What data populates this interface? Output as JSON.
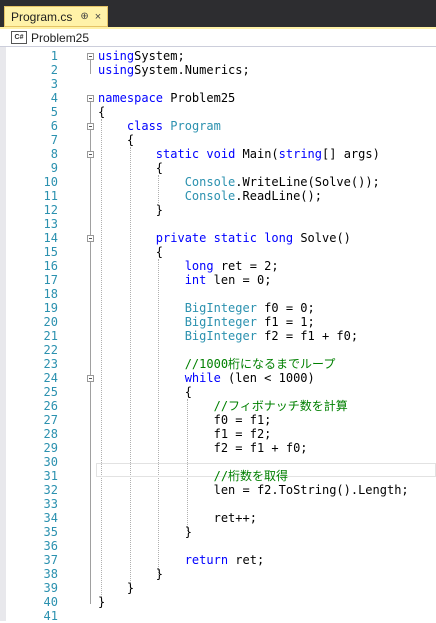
{
  "tab": {
    "title": "Program.cs",
    "pin": "⊕",
    "close": "×"
  },
  "navbar": {
    "icon": "C#",
    "label": "Problem25"
  },
  "lines": [
    [
      [
        "kw",
        "using"
      ],
      [
        "",
        "System;"
      ]
    ],
    [
      [
        "kw",
        "using"
      ],
      [
        "",
        "System.Numerics;"
      ]
    ],
    [],
    [
      [
        "kw",
        "namespace"
      ],
      [
        "",
        " Problem25"
      ]
    ],
    [
      [
        "",
        "{"
      ]
    ],
    [
      [
        "",
        "    "
      ],
      [
        "kw",
        "class"
      ],
      [
        "",
        " "
      ],
      [
        "ty",
        "Program"
      ]
    ],
    [
      [
        "",
        "    {"
      ]
    ],
    [
      [
        "",
        "        "
      ],
      [
        "kw",
        "static"
      ],
      [
        "",
        " "
      ],
      [
        "kw",
        "void"
      ],
      [
        "",
        " Main("
      ],
      [
        "kw",
        "string"
      ],
      [
        "",
        "[] args)"
      ]
    ],
    [
      [
        "",
        "        {"
      ]
    ],
    [
      [
        "",
        "            "
      ],
      [
        "ty",
        "Console"
      ],
      [
        "",
        ".WriteLine(Solve());"
      ]
    ],
    [
      [
        "",
        "            "
      ],
      [
        "ty",
        "Console"
      ],
      [
        "",
        ".ReadLine();"
      ]
    ],
    [
      [
        "",
        "        }"
      ]
    ],
    [],
    [
      [
        "",
        "        "
      ],
      [
        "kw",
        "private"
      ],
      [
        "",
        " "
      ],
      [
        "kw",
        "static"
      ],
      [
        "",
        " "
      ],
      [
        "kw",
        "long"
      ],
      [
        "",
        " Solve()"
      ]
    ],
    [
      [
        "",
        "        {"
      ]
    ],
    [
      [
        "",
        "            "
      ],
      [
        "kw",
        "long"
      ],
      [
        "",
        " ret = 2;"
      ]
    ],
    [
      [
        "",
        "            "
      ],
      [
        "kw",
        "int"
      ],
      [
        "",
        " len = 0;"
      ]
    ],
    [],
    [
      [
        "",
        "            "
      ],
      [
        "ty",
        "BigInteger"
      ],
      [
        "",
        " f0 = 0;"
      ]
    ],
    [
      [
        "",
        "            "
      ],
      [
        "ty",
        "BigInteger"
      ],
      [
        "",
        " f1 = 1;"
      ]
    ],
    [
      [
        "",
        "            "
      ],
      [
        "ty",
        "BigInteger"
      ],
      [
        "",
        " f2 = f1 + f0;"
      ]
    ],
    [],
    [
      [
        "",
        "            "
      ],
      [
        "cm",
        "//1000桁になるまでループ"
      ]
    ],
    [
      [
        "",
        "            "
      ],
      [
        "kw",
        "while"
      ],
      [
        "",
        " (len < 1000)"
      ]
    ],
    [
      [
        "",
        "            {"
      ]
    ],
    [
      [
        "",
        "                "
      ],
      [
        "cm",
        "//フィボナッチ数を計算"
      ]
    ],
    [
      [
        "",
        "                f0 = f1;"
      ]
    ],
    [
      [
        "",
        "                f1 = f2;"
      ]
    ],
    [
      [
        "",
        "                f2 = f1 + f0;"
      ]
    ],
    [],
    [
      [
        "",
        "                "
      ],
      [
        "cm",
        "//桁数を取得"
      ]
    ],
    [
      [
        "",
        "                len = f2.ToString().Length;"
      ]
    ],
    [],
    [
      [
        "",
        "                ret++;"
      ]
    ],
    [
      [
        "",
        "            }"
      ]
    ],
    [],
    [
      [
        "",
        "            "
      ],
      [
        "kw",
        "return"
      ],
      [
        "",
        " ret;"
      ]
    ],
    [
      [
        "",
        "        }"
      ]
    ],
    [
      [
        "",
        "    }"
      ]
    ],
    [
      [
        "",
        "}"
      ]
    ],
    []
  ],
  "line_numbers": [
    "1",
    "2",
    "3",
    "4",
    "5",
    "6",
    "7",
    "8",
    "9",
    "10",
    "11",
    "12",
    "13",
    "14",
    "15",
    "16",
    "17",
    "18",
    "19",
    "20",
    "21",
    "22",
    "23",
    "24",
    "25",
    "26",
    "27",
    "28",
    "29",
    "30",
    "31",
    "32",
    "33",
    "34",
    "35",
    "36",
    "37",
    "38",
    "39",
    "40",
    "41"
  ],
  "colors": {
    "keyword": "#0000ff",
    "type": "#2b91af",
    "comment": "#008000",
    "line_number": "#2b91af",
    "tab_bg": "#fff2a8",
    "chrome": "#2d2d30"
  }
}
